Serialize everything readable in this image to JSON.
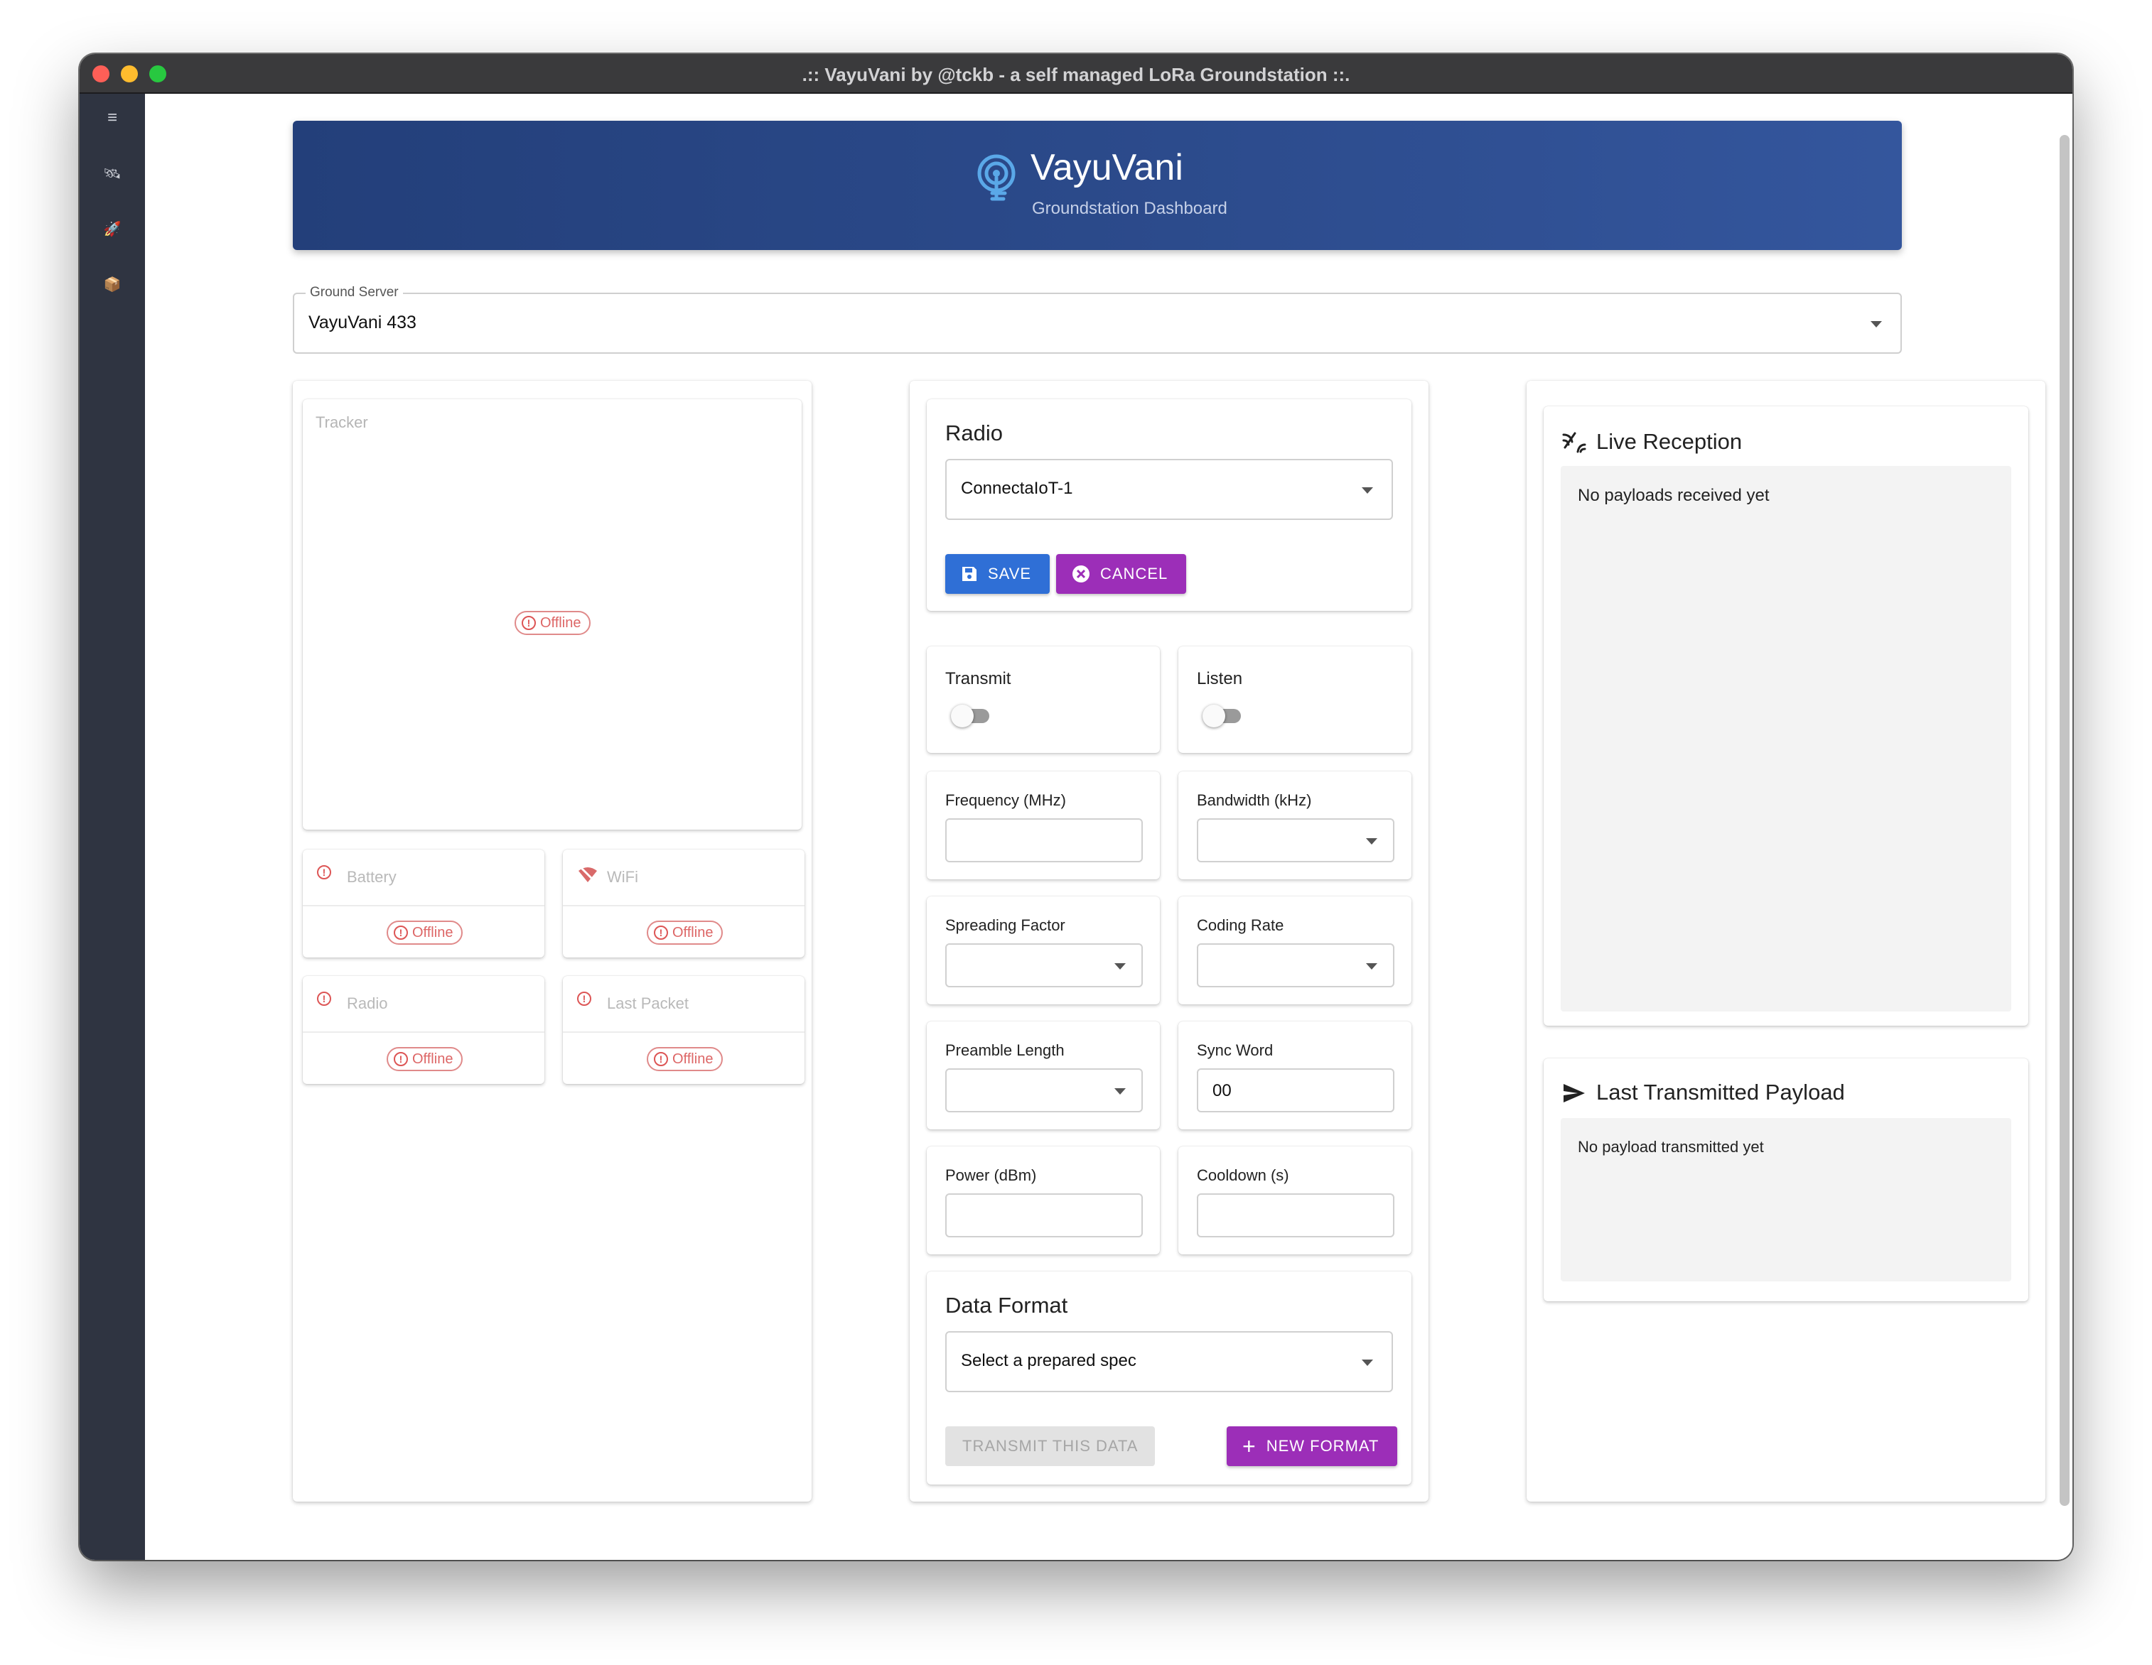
{
  "window": {
    "title": ".:: VayuVani by @tckb - a self managed LoRa Groundstation ::."
  },
  "sidebar": {
    "items": [
      {
        "icon": "menu-icon",
        "glyph": "≡"
      },
      {
        "icon": "satellite-icon",
        "glyph": "🛰"
      },
      {
        "icon": "rocket-icon",
        "glyph": "🚀"
      },
      {
        "icon": "package-icon",
        "glyph": "📦"
      }
    ]
  },
  "header": {
    "title": "VayuVani",
    "subtitle": "Groundstation Dashboard"
  },
  "ground_server": {
    "label": "Ground Server",
    "value": "VayuVani 433"
  },
  "tracker": {
    "label": "Tracker",
    "status": "Offline",
    "stats": [
      {
        "title": "Battery",
        "status": "Offline",
        "icon": "alert-icon"
      },
      {
        "title": "WiFi",
        "status": "Offline",
        "icon": "wifi-off-icon"
      },
      {
        "title": "Radio",
        "status": "Offline",
        "icon": "alert-icon"
      },
      {
        "title": "Last Packet",
        "status": "Offline",
        "icon": "alert-icon"
      }
    ]
  },
  "radio": {
    "title": "Radio",
    "selected": "ConnectaIoT-1",
    "save_label": "SAVE",
    "cancel_label": "CANCEL"
  },
  "settings": {
    "transmit": {
      "label": "Transmit",
      "on": false
    },
    "listen": {
      "label": "Listen",
      "on": false
    },
    "frequency": {
      "label": "Frequency (MHz)",
      "value": ""
    },
    "bandwidth": {
      "label": "Bandwidth (kHz)",
      "value": ""
    },
    "spreading_factor": {
      "label": "Spreading Factor",
      "value": ""
    },
    "coding_rate": {
      "label": "Coding Rate",
      "value": ""
    },
    "preamble_length": {
      "label": "Preamble Length",
      "value": ""
    },
    "sync_word": {
      "label": "Sync Word",
      "value": "00"
    },
    "power": {
      "label": "Power (dBm)",
      "value": ""
    },
    "cooldown": {
      "label": "Cooldown (s)",
      "value": ""
    }
  },
  "data_format": {
    "title": "Data Format",
    "placeholder": "Select a prepared spec",
    "transmit_label": "TRANSMIT THIS DATA",
    "new_label": "NEW FORMAT"
  },
  "live_reception": {
    "title": "Live Reception",
    "empty": "No payloads received yet"
  },
  "last_transmitted": {
    "title": "Last Transmitted Payload",
    "empty": "No payload transmitted yet"
  },
  "colors": {
    "accent_blue": "#2f6fd6",
    "accent_purple": "#9c2eb8",
    "banner": "#2c4b8c",
    "sidebar": "#2f3441",
    "offline": "#d66666"
  }
}
